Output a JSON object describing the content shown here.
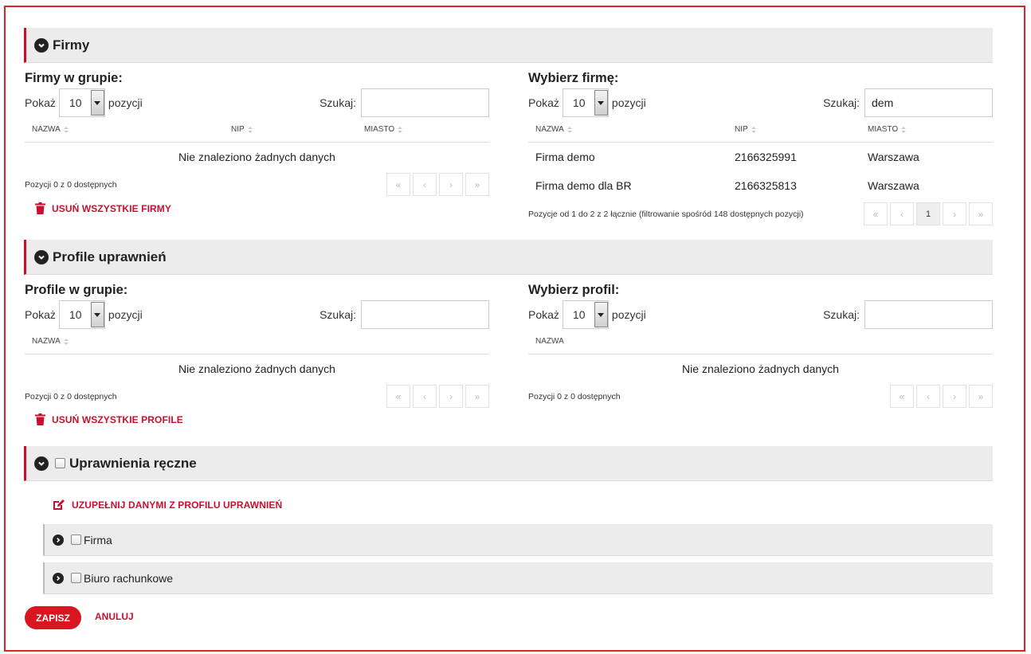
{
  "firmy_section": {
    "title": "Firmy",
    "left": {
      "title": "Firmy w grupie:",
      "show_label": "Pokaż",
      "page_size": "10",
      "show_suffix": "pozycji",
      "search_label": "Szukaj:",
      "search_value": "",
      "columns": [
        "NAZWA",
        "NIP",
        "MIASTO"
      ],
      "empty_text": "Nie znaleziono żadnych danych",
      "info": "Pozycji 0 z 0 dostępnych",
      "remove_label": "USUŃ WSZYSTKIE FIRMY"
    },
    "right": {
      "title": "Wybierz firmę:",
      "show_label": "Pokaż",
      "page_size": "10",
      "show_suffix": "pozycji",
      "search_label": "Szukaj:",
      "search_value": "dem",
      "columns": [
        "NAZWA",
        "NIP",
        "MIASTO"
      ],
      "rows": [
        {
          "nazwa": "Firma demo",
          "nip": "2166325991",
          "miasto": "Warszawa"
        },
        {
          "nazwa": "Firma demo dla BR",
          "nip": "2166325813",
          "miasto": "Warszawa"
        }
      ],
      "info": "Pozycje od 1 do 2 z 2 łącznie (filtrowanie spośród 148 dostępnych pozycji)",
      "current_page": "1"
    }
  },
  "profile_section": {
    "title": "Profile uprawnień",
    "left": {
      "title": "Profile w grupie:",
      "show_label": "Pokaż",
      "page_size": "10",
      "show_suffix": "pozycji",
      "search_label": "Szukaj:",
      "search_value": "",
      "columns": [
        "NAZWA"
      ],
      "empty_text": "Nie znaleziono żadnych danych",
      "info": "Pozycji 0 z 0 dostępnych",
      "remove_label": "USUŃ WSZYSTKIE PROFILE"
    },
    "right": {
      "title": "Wybierz profil:",
      "show_label": "Pokaż",
      "page_size": "10",
      "show_suffix": "pozycji",
      "search_label": "Szukaj:",
      "search_value": "",
      "columns": [
        "NAZWA"
      ],
      "empty_text": "Nie znaleziono żadnych danych",
      "info": "Pozycji 0 z 0 dostępnych"
    }
  },
  "manual_section": {
    "title": "Uprawnienia ręczne",
    "fill_label": "UZUPEŁNIJ DANYMI Z PROFILU UPRAWNIEŃ",
    "groups": [
      "Firma",
      "Biuro rachunkowe"
    ]
  },
  "actions": {
    "save_label": "ZAPISZ",
    "cancel_label": "ANULUJ"
  },
  "pager_glyphs": {
    "first": "«",
    "prev": "‹",
    "next": "›",
    "last": "»"
  },
  "colors": {
    "accent": "#c8102e",
    "button": "#d9161f",
    "header_bg": "#ececec"
  }
}
